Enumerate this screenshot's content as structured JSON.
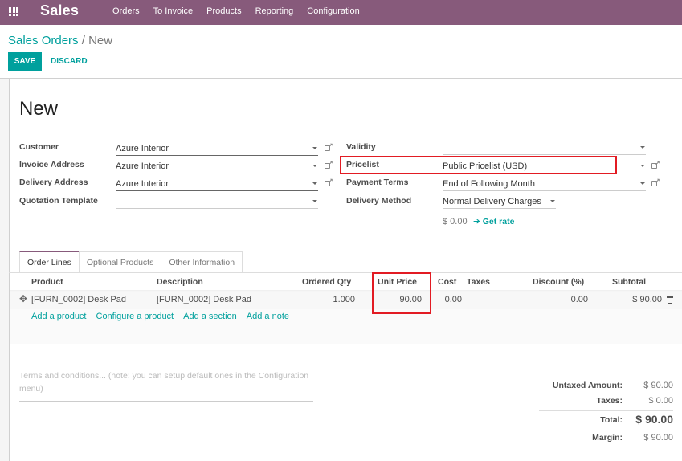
{
  "navbar": {
    "app_name": "Sales",
    "menu": [
      "Orders",
      "To Invoice",
      "Products",
      "Reporting",
      "Configuration"
    ],
    "background_color": "#875a7b"
  },
  "breadcrumb": {
    "parent": "Sales Orders",
    "separator": "/",
    "current": "New"
  },
  "actions": {
    "save_label": "SAVE",
    "discard_label": "DISCARD",
    "accent_color": "#00a09d"
  },
  "record": {
    "title": "New"
  },
  "left_fields": [
    {
      "label": "Customer",
      "value": "Azure Interior"
    },
    {
      "label": "Invoice Address",
      "value": "Azure Interior"
    },
    {
      "label": "Delivery Address",
      "value": "Azure Interior"
    },
    {
      "label": "Quotation Template",
      "value": ""
    }
  ],
  "right_fields": [
    {
      "label": "Validity",
      "value": ""
    },
    {
      "label": "Pricelist",
      "value": "Public Pricelist (USD)"
    },
    {
      "label": "Payment Terms",
      "value": "End of Following Month"
    },
    {
      "label": "Delivery Method",
      "value": "Normal Delivery Charges"
    }
  ],
  "delivery": {
    "amount": "$ 0.00",
    "get_rate_label": "Get rate"
  },
  "tabs": [
    {
      "label": "Order Lines",
      "active": true
    },
    {
      "label": "Optional Products",
      "active": false
    },
    {
      "label": "Other Information",
      "active": false
    }
  ],
  "order_lines": {
    "columns": [
      "Product",
      "Description",
      "Ordered Qty",
      "Unit Price",
      "Cost",
      "Taxes",
      "Discount (%)",
      "Subtotal"
    ],
    "rows": [
      {
        "product": "[FURN_0002] Desk Pad",
        "description": "[FURN_0002] Desk Pad",
        "ordered_qty": "1.000",
        "unit_price": "90.00",
        "cost": "0.00",
        "taxes": "",
        "discount": "0.00",
        "subtotal": "$ 90.00"
      }
    ],
    "add_links": [
      "Add a product",
      "Configure a product",
      "Add a section",
      "Add a note"
    ]
  },
  "terms": {
    "placeholder": "Terms and conditions... (note: you can setup default ones in the Configuration menu)"
  },
  "totals": {
    "untaxed_label": "Untaxed Amount:",
    "untaxed_value": "$ 90.00",
    "taxes_label": "Taxes:",
    "taxes_value": "$ 0.00",
    "total_label": "Total:",
    "total_value": "$ 90.00",
    "margin_label": "Margin:",
    "margin_value": "$ 90.00"
  },
  "annotations": {
    "highlight_color": "#e21b23",
    "highlighted": [
      "Pricelist",
      "Unit Price"
    ]
  }
}
